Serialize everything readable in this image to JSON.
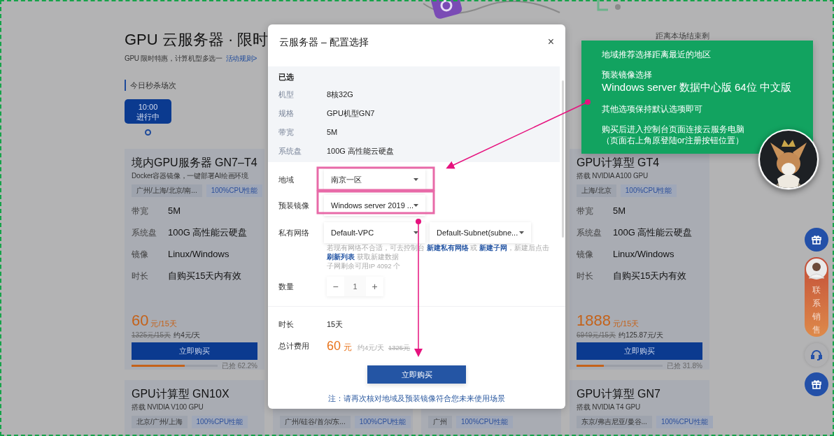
{
  "page": {
    "title": "GPU 云服务器 · 限时",
    "subtitle": "GPU 限时特惠，计算机型多选一",
    "rules_link": "活动规则>",
    "sessions_label": "今日秒杀场次",
    "sessions": [
      {
        "time": "10:00",
        "status": "进行中",
        "selected": true
      }
    ],
    "countdown_label": "距离本场结束剩"
  },
  "columns": [
    {
      "cards": [
        {
          "title": "境内GPU服务器 GN7–T4",
          "subtitle": "Docker容器镜像，一键部署AI绘画环境",
          "tags": [
            {
              "kind": "region",
              "text": "广州/上海/北京/南..."
            },
            {
              "kind": "feature",
              "text": "100%CPU性能"
            }
          ],
          "specs": [
            {
              "label": "带宽",
              "value": "5M"
            },
            {
              "label": "系统盘",
              "value": "100G 高性能云硬盘"
            },
            {
              "label": "镜像",
              "value": "Linux/Windows"
            },
            {
              "label": "时长",
              "value": "自购买15天内有效"
            }
          ],
          "price": "60",
          "price_unit": "元/15天",
          "original_price": "1325元/15天",
          "per_day": "约4元/天",
          "button": "立即购买",
          "level": 0.622,
          "sold": "已抢 62.2%"
        },
        {
          "title": "GPU计算型 GN10X",
          "subtitle": "搭载 NVIDIA V100 GPU",
          "tags": [
            {
              "kind": "region",
              "text": "北京/广州/上海"
            },
            {
              "kind": "feature",
              "text": "100%CPU性能"
            }
          ]
        }
      ]
    },
    {
      "cards": [
        {
          "tags": [
            {
              "kind": "region",
              "text": "广州/硅谷/首尔/东..."
            },
            {
              "kind": "feature",
              "text": "100%CPU性能"
            }
          ]
        }
      ]
    },
    {
      "cards": [
        {
          "tags": [
            {
              "kind": "region",
              "text": "广州"
            },
            {
              "kind": "feature",
              "text": "100%CPU性能"
            }
          ]
        }
      ]
    },
    {
      "cards": [
        {
          "title": "GPU计算型 GT4",
          "subtitle": "搭载 NVIDIA A100 GPU",
          "tags": [
            {
              "kind": "region",
              "text": "上海/北京"
            },
            {
              "kind": "feature",
              "text": "100%CPU性能"
            }
          ],
          "specs": [
            {
              "label": "带宽",
              "value": "5M"
            },
            {
              "label": "系统盘",
              "value": "100G 高性能云硬盘"
            },
            {
              "label": "镜像",
              "value": "Linux/Windows"
            },
            {
              "label": "时长",
              "value": "自购买15天内有效"
            }
          ],
          "price": "1888",
          "price_unit": "元/15天",
          "original_price": "6949元/15天",
          "per_day": "约125.87元/天",
          "button": "立即购买",
          "level": 0.318,
          "sold": "已抢 31.8%"
        },
        {
          "title": "GPU计算型 GN7",
          "subtitle": "搭载 NVIDIA T4 GPU",
          "tags": [
            {
              "kind": "region",
              "text": "东京/弗吉尼亚/曼谷..."
            },
            {
              "kind": "feature",
              "text": "100%CPU性能"
            }
          ]
        }
      ]
    }
  ],
  "modal": {
    "title": "云服务器 – 配置选择",
    "close": "×",
    "selected_heading": "已选",
    "selected": [
      {
        "label": "机型",
        "value": "8核32G"
      },
      {
        "label": "规格",
        "value": "GPU机型GN7"
      },
      {
        "label": "带宽",
        "value": "5M"
      },
      {
        "label": "系统盘",
        "value": "100G 高性能云硬盘"
      }
    ],
    "form": [
      {
        "label": "地域",
        "kind": "select",
        "values": [
          "南京一区"
        ]
      },
      {
        "label": "预装镜像",
        "kind": "select",
        "values": [
          "Windows server 2019 ..."
        ]
      },
      {
        "label": "私有网络",
        "kind": "select",
        "values": [
          "Default-VPC",
          "Default-Subnet(subne..."
        ],
        "help": [
          {
            "kind": "text",
            "text": "若现有网络不合适，可去控制台 "
          },
          {
            "kind": "link",
            "text": "新建私有网络"
          },
          {
            "kind": "text",
            "text": " 或 "
          },
          {
            "kind": "link",
            "text": "新建子网"
          },
          {
            "kind": "text",
            "text": "，新建后点击 "
          },
          {
            "kind": "link",
            "text": "刷新列表"
          },
          {
            "kind": "text",
            "text": " 获取新建数据"
          }
        ],
        "note": "子网剩余可用IP 4092 个"
      },
      {
        "label": "数量",
        "kind": "stepper",
        "value": "1",
        "decrement": "−",
        "increment": "+"
      }
    ],
    "summary": [
      {
        "label": "时长",
        "kind": "text",
        "value": "15天"
      },
      {
        "label": "总计费用",
        "kind": "price",
        "value": "60",
        "unit": "元",
        "per_day": "约4元/天",
        "original": "1325元"
      }
    ],
    "button": "立即购买",
    "note": "注：请再次核对地域及预装镜像符合您未来使用场景"
  },
  "annotation": {
    "items": [
      {
        "kind": "line",
        "text": "地域推荐选择距离最近的地区"
      },
      {
        "kind": "line",
        "text": "预装镜像选择"
      },
      {
        "kind": "large",
        "text": "Windows server 数据中心版 64位 中文版"
      },
      {
        "kind": "line",
        "text": "其他选项保持默认选项即可"
      },
      {
        "kind": "line",
        "text": "购买后进入控制台页面连接云服务电脑"
      },
      {
        "kind": "cont",
        "text": "（页面右上角原登陆or注册按钮位置）"
      }
    ]
  },
  "float_bar": {
    "contact_sales": "联系销售"
  }
}
